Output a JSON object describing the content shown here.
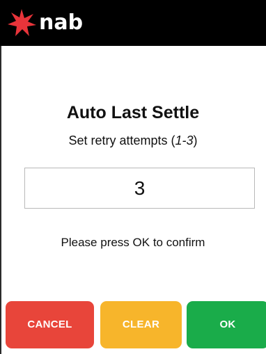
{
  "header": {
    "brand": "nab",
    "logo_icon": "nab-star-icon",
    "logo_color": "#e8343a",
    "background": "#000000"
  },
  "main": {
    "title": "Auto Last Settle",
    "subtitle_prefix": "Set retry attempts (",
    "subtitle_range": "1-3",
    "subtitle_suffix": ")",
    "input_value": "3",
    "confirm_text": "Please press OK to confirm"
  },
  "buttons": {
    "cancel_label": "CANCEL",
    "clear_label": "CLEAR",
    "ok_label": "OK",
    "cancel_color": "#e8453a",
    "clear_color": "#f7b52b",
    "ok_color": "#1aac4a"
  }
}
